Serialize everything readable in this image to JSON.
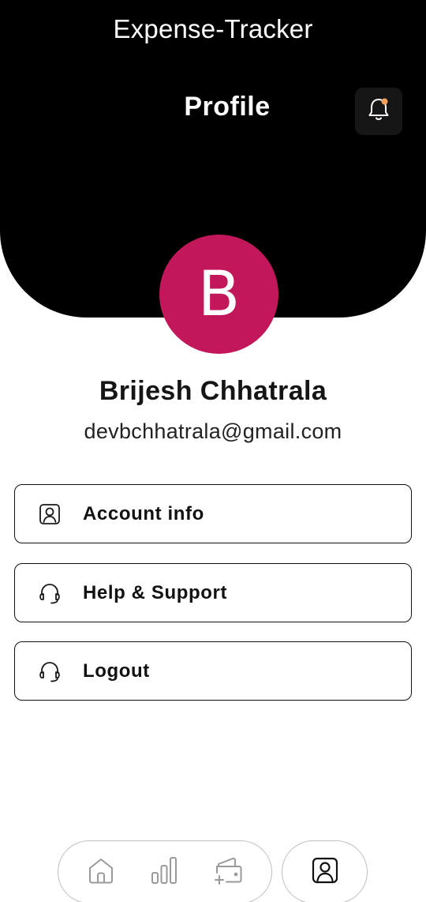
{
  "app": {
    "title": "Expense-Tracker"
  },
  "header": {
    "page_title": "Profile",
    "notification_icon": "bell-icon",
    "notification_dot_color": "#f4a261"
  },
  "profile": {
    "avatar_initial": "B",
    "avatar_color": "#c2185b",
    "name": "Brijesh Chhatrala",
    "email": "devbchhatrala@gmail.com"
  },
  "menu": [
    {
      "label": "Account info",
      "icon": "user-square-icon"
    },
    {
      "label": "Help & Support",
      "icon": "headset-icon"
    },
    {
      "label": "Logout",
      "icon": "headset-icon"
    }
  ],
  "bottom_nav": {
    "items": [
      {
        "name": "home",
        "icon": "home-icon"
      },
      {
        "name": "stats",
        "icon": "bar-chart-icon"
      },
      {
        "name": "wallet",
        "icon": "wallet-add-icon"
      },
      {
        "name": "profile",
        "icon": "user-square-icon",
        "active": true
      }
    ]
  }
}
